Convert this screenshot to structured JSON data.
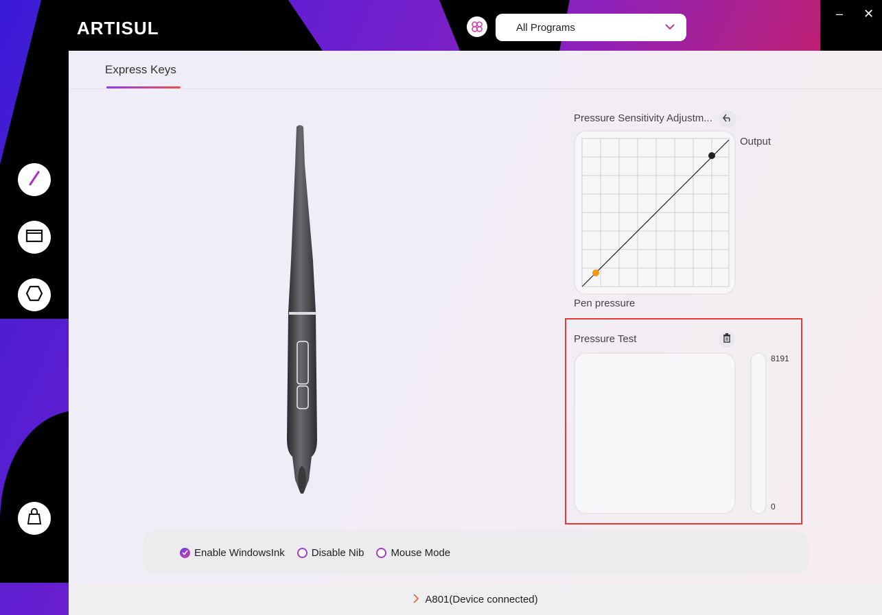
{
  "app": {
    "logo_text": "ARTISUL"
  },
  "header": {
    "program_select": {
      "value": "All Programs"
    },
    "window_controls": {
      "minimize": "–",
      "close": "✕"
    }
  },
  "tabs": [
    {
      "label": "Express Keys",
      "active": true
    }
  ],
  "sidebar": {
    "items": [
      {
        "icon": "pen-icon"
      },
      {
        "icon": "display-icon"
      },
      {
        "icon": "hexagon-icon"
      },
      {
        "icon": "store-bag-icon"
      }
    ]
  },
  "pressure_sensitivity": {
    "title": "Pressure Sensitivity Adjustm...",
    "output_label": "Output",
    "input_label": "Pen pressure"
  },
  "pressure_test": {
    "title": "Pressure Test",
    "max_value": "8191",
    "min_value": "0"
  },
  "options": [
    {
      "label": "Enable WindowsInk",
      "checked": true
    },
    {
      "label": "Disable Nib",
      "checked": false
    },
    {
      "label": "Mouse Mode",
      "checked": false
    }
  ],
  "status": {
    "device": "A801(Device connected)"
  },
  "colors": {
    "accent_purple": "#8a3cf0",
    "accent_red": "#f0504a",
    "highlight_border": "#e53935"
  }
}
